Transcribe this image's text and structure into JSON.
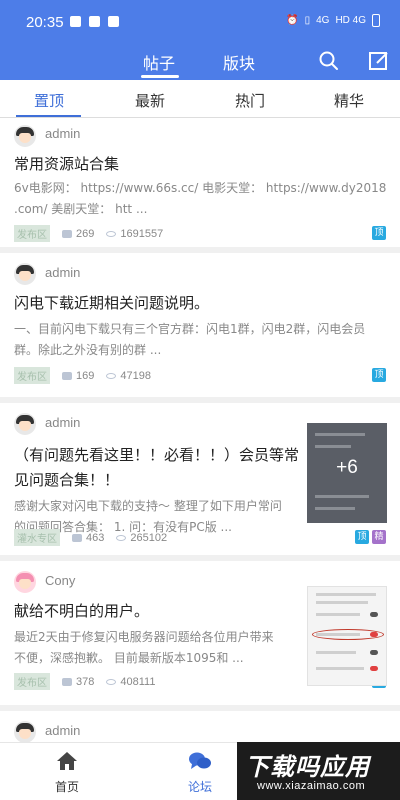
{
  "status_bar": {
    "time": "20:35",
    "network_left": "4G",
    "network_right": "HD 4G"
  },
  "app_bar": {
    "tabs": [
      "帖子",
      "版块"
    ],
    "active_tab": "帖子"
  },
  "sub_tabs": {
    "items": [
      "置顶",
      "最新",
      "热门",
      "精华"
    ],
    "active": "置顶"
  },
  "posts": [
    {
      "author": "admin",
      "title": "常用资源站合集",
      "excerpt": [
        "6v电影网： https://www.66s.cc/ 电影天堂： https://www.dy2018",
        ".com/ 美剧天堂： htt ..."
      ],
      "forum": "发布区",
      "comments": "269",
      "views": "1691557",
      "badges": [
        "顶"
      ]
    },
    {
      "author": "admin",
      "title": "闪电下载近期相关问题说明。",
      "excerpt": [
        "一、目前闪电下载只有三个官方群：闪电1群，闪电2群，闪电会员",
        "群。除此之外没有别的群 ..."
      ],
      "forum": "发布区",
      "comments": "169",
      "views": "47198",
      "badges": [
        "顶"
      ]
    },
    {
      "author": "admin",
      "title": [
        "（有问题先看这里！！必看！！）会员等常",
        "见问题合集！！"
      ],
      "excerpt": [
        "感谢大家对闪电下载的支持～ 整理了如下用户常问",
        "的问题回答合集： 1. 问：有没有PC版 ..."
      ],
      "forum": "灌水专区",
      "comments": "463",
      "views": "265102",
      "badges": [
        "顶",
        "精"
      ],
      "thumb_more": "+6"
    },
    {
      "author": "Cony",
      "title": "献给不明白的用户。",
      "excerpt": [
        "最近2天由于修复闪电服务器问题给各位用户带来",
        "不便，深感抱歉。 目前最新版本1095和 ..."
      ],
      "forum": "发布区",
      "comments": "378",
      "views": "408111",
      "badges": [
        "顶"
      ]
    },
    {
      "author": "admin"
    }
  ],
  "bottom_nav": {
    "home": "首页",
    "forum": "论坛"
  },
  "watermark": {
    "big": "下载吗应用",
    "small": "www.xiazaimao.com"
  },
  "colors": {
    "primary": "#4d7de8",
    "accent": "#3f6fd8",
    "top_badge": "#28a9e0",
    "essence_badge": "#a472ca"
  }
}
